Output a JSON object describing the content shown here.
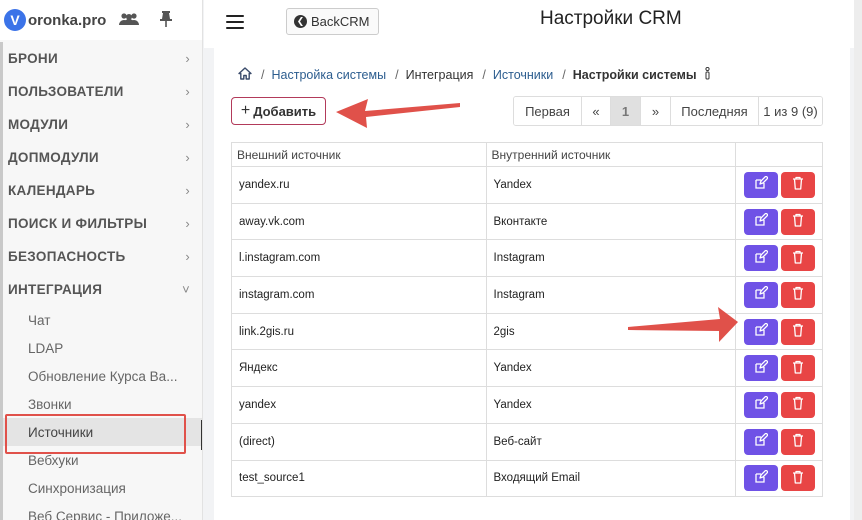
{
  "brand": {
    "logo_letter": "V",
    "name": "oronka.pro"
  },
  "topbar": {
    "back_label": "BackCRM",
    "title": "Настройки CRM"
  },
  "sidebar": {
    "sections": [
      {
        "label": "БРОНИ",
        "chevron": "›"
      },
      {
        "label": "ПОЛЬЗОВАТЕЛИ",
        "chevron": "›"
      },
      {
        "label": "МОДУЛИ",
        "chevron": "›"
      },
      {
        "label": "ДОПМОДУЛИ",
        "chevron": "›"
      },
      {
        "label": "КАЛЕНДАРЬ",
        "chevron": "›"
      },
      {
        "label": "ПОИСК И ФИЛЬТРЫ",
        "chevron": "›"
      },
      {
        "label": "БЕЗОПАСНОСТЬ",
        "chevron": "›"
      },
      {
        "label": "ИНТЕГРАЦИЯ",
        "chevron": "˅"
      }
    ],
    "sub_items": [
      "Чат",
      "LDAP",
      "Обновление Курса Ва...",
      "Звонки",
      "Источники",
      "Вебхуки",
      "Синхронизация",
      "Веб Сервис - Приложе..."
    ]
  },
  "breadcrumb": {
    "items": [
      "Настройка системы",
      "Интеграция",
      "Источники",
      "Настройки системы"
    ]
  },
  "toolbar": {
    "add_label": "Добавить"
  },
  "pagination": {
    "first": "Первая",
    "prev": "«",
    "current": "1",
    "next": "»",
    "last": "Последняя",
    "info": "1 из 9 (9)"
  },
  "table": {
    "headers": [
      "Внешний источник",
      "Внутренний источник"
    ],
    "rows": [
      [
        "yandex.ru",
        "Yandex"
      ],
      [
        "away.vk.com",
        "Вконтакте"
      ],
      [
        "l.instagram.com",
        "Instagram"
      ],
      [
        "instagram.com",
        "Instagram"
      ],
      [
        "link.2gis.ru",
        "2gis"
      ],
      [
        "Яндекс",
        "Yandex"
      ],
      [
        "yandex",
        "Yandex"
      ],
      [
        "(direct)",
        "Веб-сайт"
      ],
      [
        "test_source1",
        "Входящий Email"
      ]
    ]
  },
  "colors": {
    "edit": "#6f52e6",
    "delete": "#e84545",
    "annotation": "#e0514a"
  }
}
